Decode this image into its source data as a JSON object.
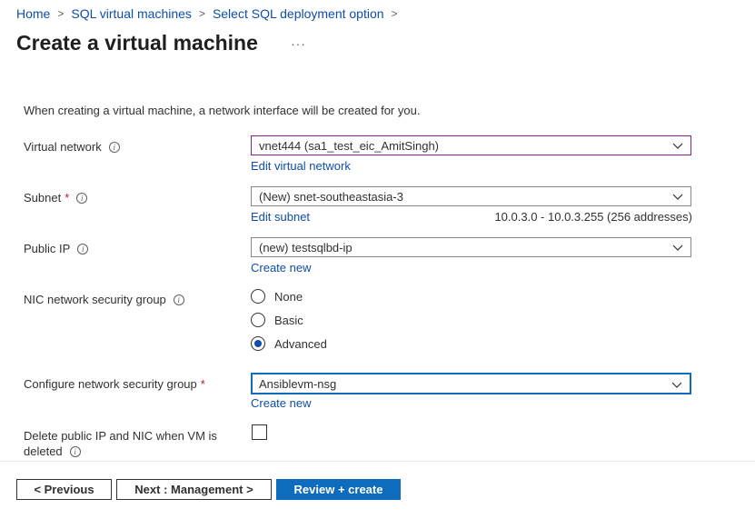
{
  "breadcrumb": {
    "items": [
      "Home",
      "SQL virtual machines",
      "Select SQL deployment option"
    ],
    "separator": ">"
  },
  "page": {
    "title": "Create a virtual machine",
    "more": "···",
    "intro": "When creating a virtual machine, a network interface will be created for you."
  },
  "fields": {
    "virtual_network": {
      "label": "Virtual network",
      "value": "vnet444 (sa1_test_eic_AmitSingh)",
      "link": "Edit virtual network"
    },
    "subnet": {
      "label": "Subnet",
      "required": "*",
      "value": "(New) snet-southeastasia-3",
      "link": "Edit subnet",
      "address_info": "10.0.3.0 - 10.0.3.255 (256 addresses)"
    },
    "public_ip": {
      "label": "Public IP",
      "value": "(new) testsqlbd-ip",
      "link": "Create new"
    },
    "nic_nsg": {
      "label": "NIC network security group",
      "options": [
        "None",
        "Basic",
        "Advanced"
      ],
      "selected": "Advanced"
    },
    "configure_nsg": {
      "label": "Configure network security group",
      "required": "*",
      "value": "Ansiblevm-nsg",
      "link": "Create new"
    },
    "delete_on_vm_delete": {
      "label_line1": "Delete public IP and NIC when VM is",
      "label_line2": "deleted",
      "checked": false
    }
  },
  "footer": {
    "previous": "< Previous",
    "next": "Next : Management >",
    "review": "Review + create"
  },
  "icons": {
    "info": "info-icon",
    "chevron": "chevron-down-icon",
    "info_glyph": "i"
  },
  "colors": {
    "link": "#0f4ea8",
    "primary": "#0f6cbd",
    "required": "#a4262c"
  }
}
